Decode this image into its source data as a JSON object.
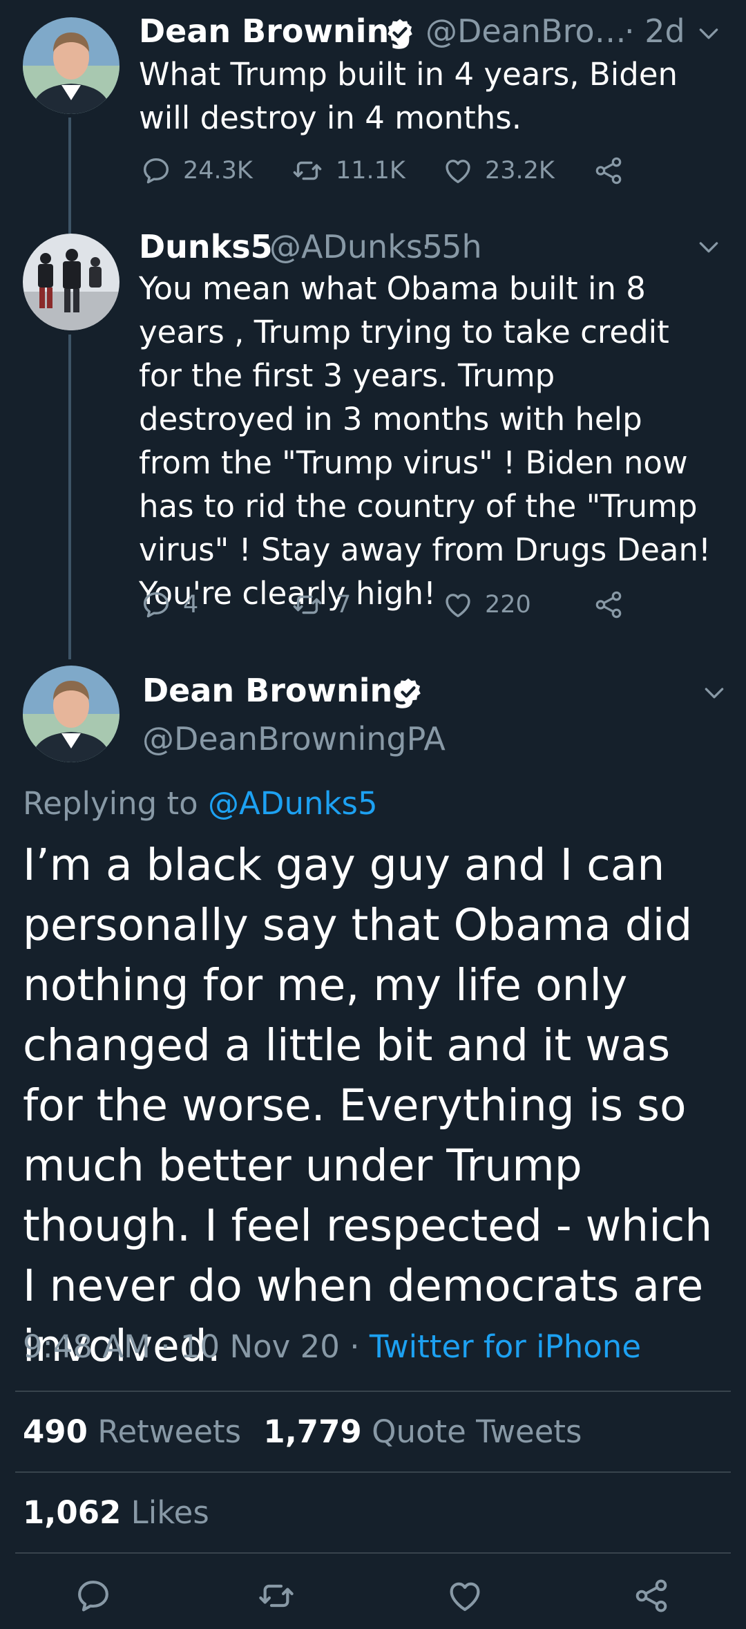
{
  "thread": [
    {
      "name": "Dean Browning",
      "handle": "@DeanBro…",
      "time": "· 2d",
      "text": "What Trump built in 4 years, Biden will destroy in 4 months.",
      "replies": "24.3K",
      "retweets": "11.1K",
      "likes": "23.2K"
    },
    {
      "name": "Dunks5",
      "handle": "@ADunks5",
      "time": "· 5h",
      "text": "You mean what Obama built in 8 years , Trump trying to take credit for the first 3 years. Trump destroyed in 3 months with help from the \"Trump virus\" ! Biden now has to rid the country of the \"Trump virus\" ! Stay away from Drugs Dean! You're clearly high!",
      "replies": "4",
      "retweets": "7",
      "likes": "220"
    }
  ],
  "main_tweet": {
    "name": "Dean Browning",
    "handle": "@DeanBrowningPA",
    "replying_prefix": "Replying to",
    "replying_to": "@ADunks5",
    "text": "I’m a black gay guy and I can personally say that Obama did nothing for me, my life only changed a little bit and it was for the worse. Everything is so much better under Trump though. I feel respected - which I never do when democrats are involved.",
    "time": "9:48 AM",
    "date": "10 Nov 20",
    "sep": "·",
    "source": "Twitter for iPhone",
    "retweets_count": "490",
    "retweets_label": "Retweets",
    "quotes_count": "1,779",
    "quotes_label": "Quote Tweets",
    "likes_count": "1,062",
    "likes_label": "Likes"
  },
  "icons": [
    "reply-icon",
    "retweet-icon",
    "like-icon",
    "share-icon",
    "verified-badge-icon",
    "chevron-down-icon"
  ],
  "colors": {
    "background": "#15202b",
    "text": "#ffffff",
    "muted": "#8899a6",
    "link": "#1da1f2",
    "divider": "#38444d"
  }
}
